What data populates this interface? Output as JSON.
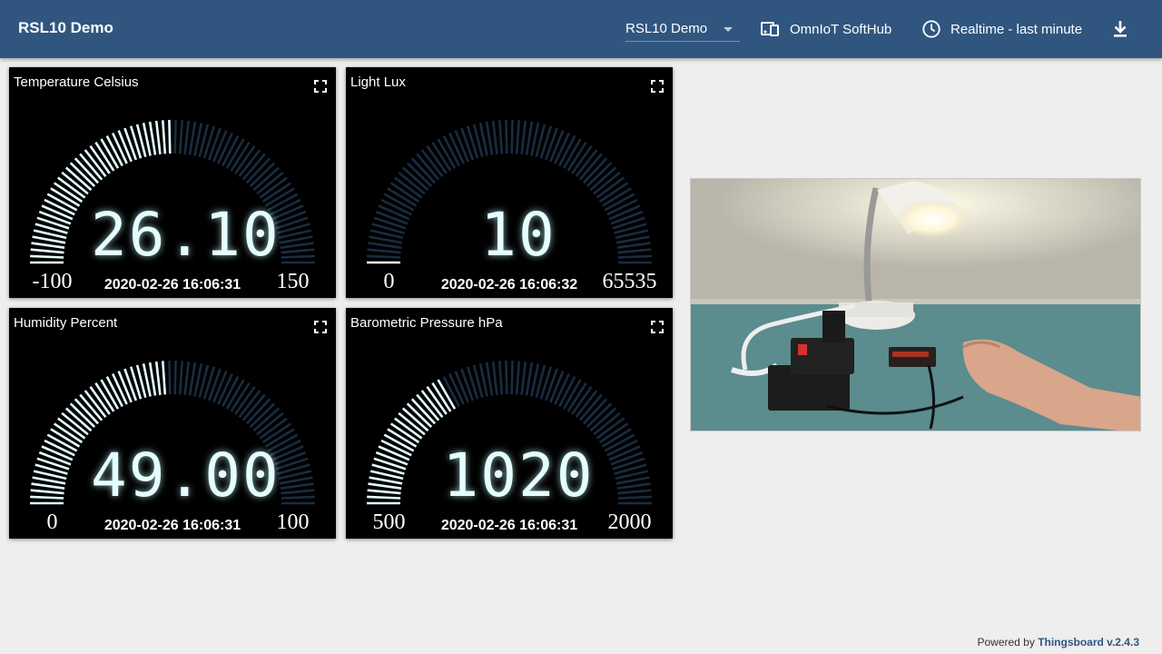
{
  "header": {
    "title": "RSL10 Demo",
    "dashboard_select": "RSL10 Demo",
    "customer_label": "OmnIoT SoftHub",
    "timewindow_label": "Realtime - last minute"
  },
  "widgets": [
    {
      "title": "Temperature Celsius",
      "value": "26.10",
      "min": "-100",
      "max": "150",
      "timestamp": "2020-02-26 16:06:31",
      "fraction": 0.504
    },
    {
      "title": "Light Lux",
      "value": "10",
      "min": "0",
      "max": "65535",
      "timestamp": "2020-02-26 16:06:32",
      "fraction": 0.0002
    },
    {
      "title": "Humidity Percent",
      "value": "49.00",
      "min": "0",
      "max": "100",
      "timestamp": "2020-02-26 16:06:31",
      "fraction": 0.49
    },
    {
      "title": "Barometric Pressure hPa",
      "value": "1020",
      "min": "500",
      "max": "2000",
      "timestamp": "2020-02-26 16:06:31",
      "fraction": 0.347
    }
  ],
  "colors": {
    "header": "#305680",
    "gauge_active": "#e4fdff",
    "gauge_inactive": "#1a2c40"
  },
  "footer": {
    "prefix": "Powered by",
    "link": "Thingsboard v.2.4.3"
  }
}
